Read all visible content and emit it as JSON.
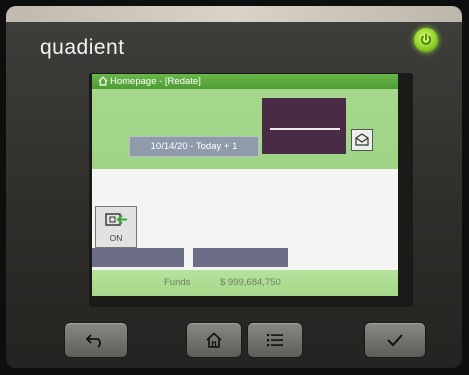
{
  "brand": {
    "name": "quadient"
  },
  "screen": {
    "title": "Homepage - [Redate]",
    "date_button_label": "10/14/20 - Today + 1",
    "ink_status_label": "ON",
    "funds_label": "Funds",
    "funds_value": "$ 999,684,750"
  },
  "colors": {
    "title_bar": "#4e9b34",
    "screen_green": "#a7d98f",
    "stamp_preview": "#4a2b46",
    "date_button": "#8f9aaa",
    "power_led": "#8fd12a"
  },
  "icons": {
    "power": "power-icon",
    "home": "home-icon",
    "envelope": "envelope-icon",
    "ink_refill": "ink-refill-icon",
    "back": "back-arrow-icon",
    "menu": "menu-list-icon",
    "confirm": "checkmark-icon"
  }
}
